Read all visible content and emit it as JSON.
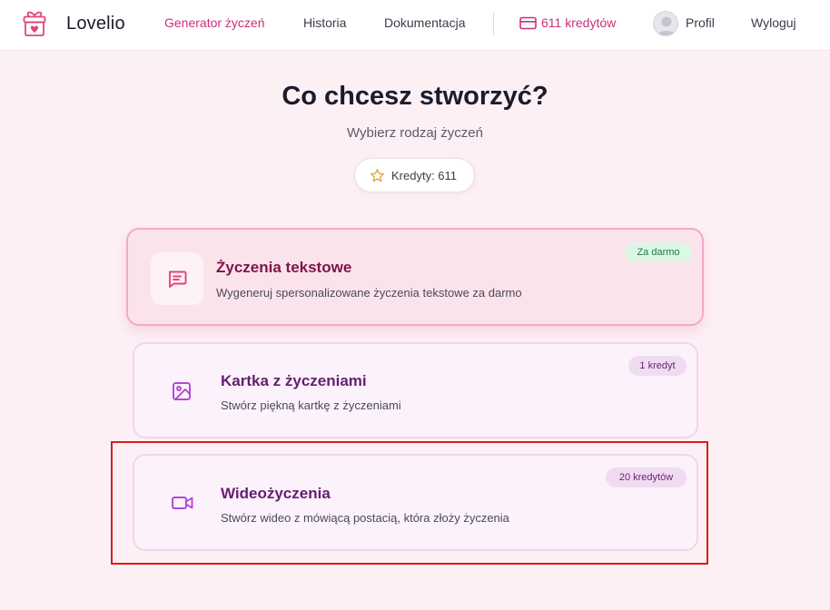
{
  "brand": {
    "name": "Lovelio"
  },
  "nav": {
    "generator": "Generator życzeń",
    "history": "Historia",
    "docs": "Dokumentacja",
    "credits": "611 kredytów",
    "profile": "Profil",
    "logout": "Wyloguj"
  },
  "hero": {
    "title": "Co chcesz stworzyć?",
    "subtitle": "Wybierz rodzaj życzeń",
    "credits_pill": "Kredyty: 611"
  },
  "cards": [
    {
      "title": "Życzenia tekstowe",
      "description": "Wygeneruj spersonalizowane życzenia tekstowe za darmo",
      "badge": "Za darmo",
      "icon": "message-square-icon"
    },
    {
      "title": "Kartka z życzeniami",
      "description": "Stwórz piękną kartkę z życzeniami",
      "badge": "1 kredyt",
      "icon": "image-icon"
    },
    {
      "title": "Wideożyczenia",
      "description": "Stwórz wideo z mówiącą postacią, która złoży życzenia",
      "badge": "20 kredytów",
      "icon": "video-icon"
    }
  ],
  "colors": {
    "accent": "#cc2f78",
    "background": "#fdf0f5",
    "highlight": "#e01a1a",
    "free_badge": "#dcf7e6",
    "paid_badge": "#f0dcf1"
  }
}
